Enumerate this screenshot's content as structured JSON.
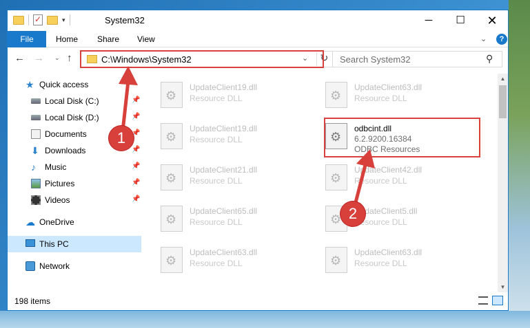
{
  "window": {
    "title": "System32",
    "min_label": "─",
    "max_label": "☐",
    "close_label": "✕"
  },
  "ribbon": {
    "tabs": [
      "File",
      "Home",
      "Share",
      "View"
    ],
    "expand_label": "⌄",
    "help_label": "?"
  },
  "nav": {
    "back_label": "←",
    "forward_label": "→",
    "recent_label": "⌄",
    "up_label": "↑",
    "address": "C:\\Windows\\System32",
    "address_dropdown_label": "⌄",
    "refresh_label": "↻",
    "search_placeholder": "Search System32",
    "search_icon_label": "⚲"
  },
  "sidebar": {
    "items": [
      {
        "label": "Quick access",
        "icon": "star-icon",
        "pinned": false
      },
      {
        "label": "Local Disk (C:)",
        "icon": "drive-icon",
        "pinned": true
      },
      {
        "label": "Local Disk (D:)",
        "icon": "drive-icon",
        "pinned": true
      },
      {
        "label": "Documents",
        "icon": "documents-icon",
        "pinned": true
      },
      {
        "label": "Downloads",
        "icon": "download-icon",
        "pinned": true
      },
      {
        "label": "Music",
        "icon": "music-icon",
        "pinned": true
      },
      {
        "label": "Pictures",
        "icon": "pictures-icon",
        "pinned": true
      },
      {
        "label": "Videos",
        "icon": "videos-icon",
        "pinned": true
      },
      {
        "label": "OneDrive",
        "icon": "cloud-icon",
        "pinned": false
      },
      {
        "label": "This PC",
        "icon": "computer-icon",
        "pinned": false,
        "selected": true
      },
      {
        "label": "Network",
        "icon": "network-icon",
        "pinned": false
      }
    ],
    "pin_label": "📌"
  },
  "files": [
    {
      "name": "UpdateClient19.dll",
      "type": "Resource DLL"
    },
    {
      "name": "UpdateClient63.dll",
      "type": "Resource DLL"
    },
    {
      "name": "UpdateClient19.dll",
      "type": "Resource DLL"
    },
    {
      "name": "odbcint.dll",
      "type": "6.2.9200.16384",
      "desc": "ODBC Resources",
      "highlighted": true
    },
    {
      "name": "UpdateClient21.dll",
      "type": "Resource DLL"
    },
    {
      "name": "UpdateClient42.dll",
      "type": "Resource DLL"
    },
    {
      "name": "UpdateClient65.dll",
      "type": "Resource DLL"
    },
    {
      "name": "UpdateClient5.dll",
      "type": "Resource DLL"
    },
    {
      "name": "UpdateClient63.dll",
      "type": "Resource DLL"
    },
    {
      "name": "UpdateClient63.dll",
      "type": "Resource DLL"
    }
  ],
  "status": {
    "item_count": "198 items"
  },
  "annotations": {
    "step1": "1",
    "step2": "2"
  },
  "colors": {
    "accent": "#1979ca",
    "highlight_red": "#d8403c",
    "selected_bg": "#cce8ff"
  }
}
